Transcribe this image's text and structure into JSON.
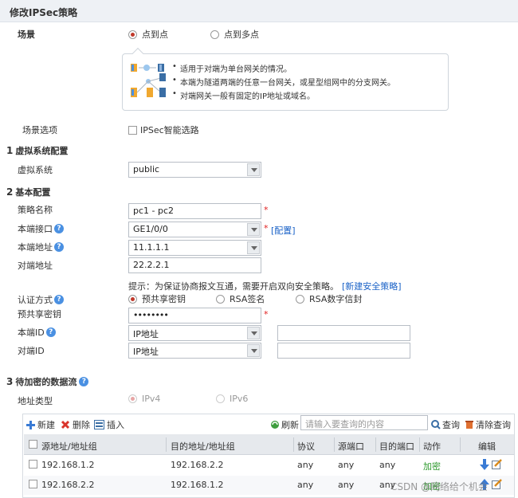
{
  "header": {
    "title": "修改IPSec策略"
  },
  "scene": {
    "label": "场景",
    "options": [
      {
        "label": "点到点",
        "selected": true
      },
      {
        "label": "点到多点",
        "selected": false
      }
    ],
    "tips": [
      "适用于对端为单台网关的情况。",
      "本端为隧道两端的任意一台网关，或星型组网中的分支网关。",
      "对端网关一般有固定的IP地址或域名。"
    ]
  },
  "scene_option": {
    "label": "场景选项",
    "checkbox_label": "IPSec智能选路",
    "checked": false
  },
  "section1": {
    "num": "1",
    "title": "虚拟系统配置",
    "vsys_label": "虚拟系统",
    "vsys_value": "public"
  },
  "section2": {
    "num": "2",
    "title": "基本配置",
    "policy_name_label": "策略名称",
    "policy_name_value": "pc1 - pc2",
    "local_if_label": "本端接口",
    "local_if_value": "GE1/0/0",
    "config_link": "[配置]",
    "local_addr_label": "本端地址",
    "local_addr_value": "11.1.1.1",
    "peer_addr_label": "对端地址",
    "peer_addr_value": "22.2.2.1",
    "hint_text": "提示：为保证协商报文互通，需要开启双向安全策略。",
    "hint_link": "[新建安全策略]",
    "auth_label": "认证方式",
    "auth_options": [
      {
        "label": "预共享密钥",
        "selected": true
      },
      {
        "label": "RSA签名",
        "selected": false
      },
      {
        "label": "RSA数字信封",
        "selected": false
      }
    ],
    "psk_label": "预共享密钥",
    "psk_value": "••••••••",
    "local_id_label": "本端ID",
    "local_id_value": "IP地址",
    "local_id_text": "",
    "peer_id_label": "对端ID",
    "peer_id_value": "IP地址",
    "peer_id_text": "",
    "required_mark": "*"
  },
  "section3": {
    "num": "3",
    "title": "待加密的数据流",
    "addr_type_label": "地址类型",
    "addr_types": [
      {
        "label": "IPv4",
        "selected": true
      },
      {
        "label": "IPv6",
        "selected": false
      }
    ],
    "toolbar": {
      "new": "新建",
      "delete": "删除",
      "insert": "插入",
      "refresh": "刷新",
      "search_placeholder": "请输入要查询的内容",
      "search": "查询",
      "clear": "清除查询"
    },
    "columns": [
      "源地址/地址组",
      "目的地址/地址组",
      "协议",
      "源端口",
      "目的端口",
      "动作",
      "编辑"
    ],
    "rows": [
      {
        "src": "192.168.1.2",
        "dst": "192.168.2.2",
        "proto": "any",
        "sport": "any",
        "dport": "any",
        "action": "加密"
      },
      {
        "src": "192.168.2.2",
        "dst": "192.168.1.2",
        "proto": "any",
        "sport": "any",
        "dport": "any",
        "action": "加密"
      }
    ]
  },
  "watermark": "CSDN @网络给个机会",
  "colors": {
    "accent": "#c0392b",
    "link": "#1a62c7",
    "action_green": "#2e9a2e"
  }
}
